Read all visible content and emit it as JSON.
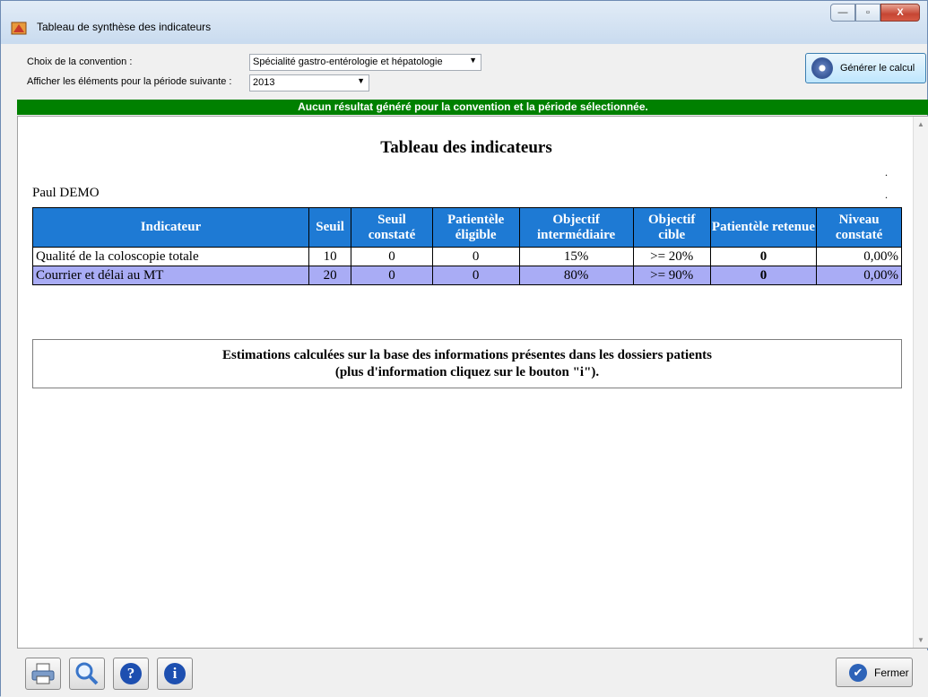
{
  "window": {
    "title": "Tableau de synthèse des indicateurs",
    "min": "—",
    "max": "▫",
    "close": "X"
  },
  "filters": {
    "convention_label": "Choix de la convention :",
    "convention_value": "Spécialité gastro-entérologie et hépatologie",
    "period_label": "Afficher les éléments pour la période suivante :",
    "period_value": "2013"
  },
  "generate_label": "Générer le calcul",
  "status_message": "Aucun résultat généré pour la convention et la période sélectionnée.",
  "content": {
    "title": "Tableau des indicateurs",
    "patient_name": "Paul DEMO",
    "table": {
      "headers": [
        "Indicateur",
        "Seuil",
        "Seuil constaté",
        "Patientèle éligible",
        "Objectif intermédiaire",
        "Objectif cible",
        "Patientèle retenue",
        "Niveau constaté"
      ],
      "rows": [
        [
          "Qualité de la coloscopie totale",
          "10",
          "0",
          "0",
          "15%",
          ">= 20%",
          "0",
          "0,00%"
        ],
        [
          "Courrier et délai au MT",
          "20",
          "0",
          "0",
          "80%",
          ">= 90%",
          "0",
          "0,00%"
        ]
      ]
    },
    "note_line1": "Estimations calculées sur la base des informations présentes dans les dossiers patients",
    "note_line2": "(plus d'information cliquez sur le bouton \"i\")."
  },
  "bottom": {
    "help_glyph": "?",
    "info_glyph": "i",
    "close_label": "Fermer",
    "close_glyph": "✔"
  },
  "colors": {
    "status_bar": "#008000",
    "table_header": "#1e7ad4",
    "table_alt_row": "#a9acf5"
  }
}
